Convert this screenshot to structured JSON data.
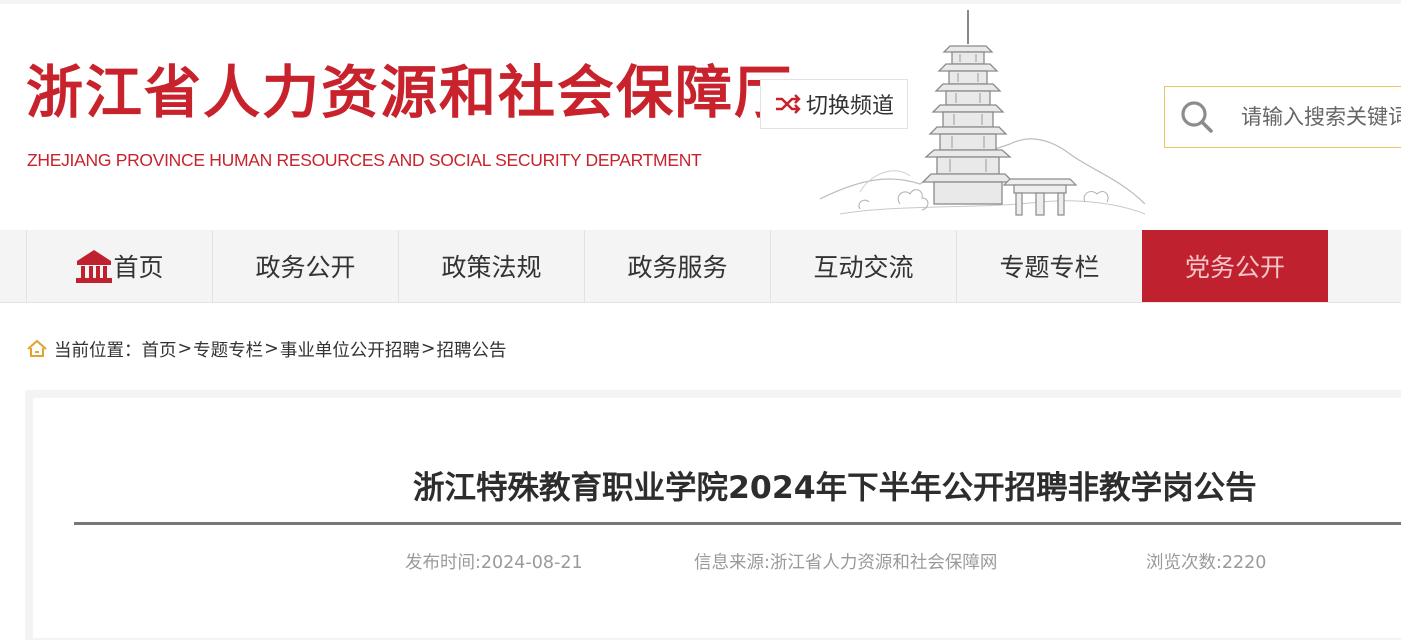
{
  "header": {
    "logo_cn": "浙江省人力资源和社会保障厅",
    "logo_en": "ZHEJIANG PROVINCE HUMAN RESOURCES AND SOCIAL SECURITY DEPARTMENT",
    "switch_label": "切换频道",
    "search_placeholder": "请输入搜索关键词"
  },
  "nav": {
    "items": [
      {
        "label": "首页",
        "icon": "home-temple-icon"
      },
      {
        "label": "政务公开"
      },
      {
        "label": "政策法规"
      },
      {
        "label": "政务服务"
      },
      {
        "label": "互动交流"
      },
      {
        "label": "专题专栏"
      },
      {
        "label": "党务公开",
        "active": true
      }
    ]
  },
  "breadcrumb": {
    "prefix": "当前位置：",
    "items": [
      "首页",
      "专题专栏",
      "事业单位公开招聘",
      "招聘公告"
    ],
    "separator": ">"
  },
  "article": {
    "title": "浙江特殊教育职业学院2024年下半年公开招聘非教学岗公告",
    "publish_time": "发布时间:2024-08-21",
    "source": "信息来源:浙江省人力资源和社会保障网",
    "views": "浏览次数:2220"
  },
  "colors": {
    "brand_red": "#c8232c",
    "nav_active": "#c0212f",
    "search_border": "#e8c46a",
    "breadcrumb_icon": "#e3a32a"
  }
}
